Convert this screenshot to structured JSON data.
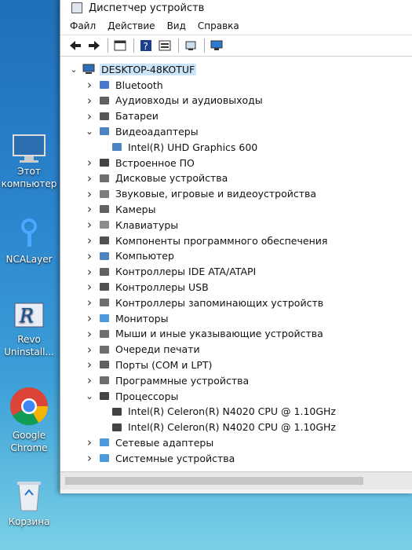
{
  "desktop": {
    "icons": [
      {
        "name": "this-pc",
        "label": "Этот компьютер"
      },
      {
        "name": "ncalayer",
        "label": "NCALayer"
      },
      {
        "name": "revo",
        "label": "Revo Uninstall..."
      },
      {
        "name": "chrome",
        "label": "Google Chrome"
      },
      {
        "name": "recycle",
        "label": "Корзина"
      }
    ]
  },
  "window": {
    "title": "Диспетчер устройств",
    "menu": [
      "Файл",
      "Действие",
      "Вид",
      "Справка"
    ]
  },
  "tree": {
    "root": "DESKTOP-48KOTUF",
    "items": [
      {
        "label": "Bluetooth",
        "expanded": false
      },
      {
        "label": "Аудиовходы и аудиовыходы",
        "expanded": false
      },
      {
        "label": "Батареи",
        "expanded": false
      },
      {
        "label": "Видеоадаптеры",
        "expanded": true
      },
      {
        "label": "Intel(R) UHD Graphics 600",
        "child": true
      },
      {
        "label": "Встроенное ПО",
        "expanded": false
      },
      {
        "label": "Дисковые устройства",
        "expanded": false
      },
      {
        "label": "Звуковые, игровые и видеоустройства",
        "expanded": false
      },
      {
        "label": "Камеры",
        "expanded": false
      },
      {
        "label": "Клавиатуры",
        "expanded": false
      },
      {
        "label": "Компоненты программного обеспечения",
        "expanded": false
      },
      {
        "label": "Компьютер",
        "expanded": false
      },
      {
        "label": "Контроллеры IDE ATA/ATAPI",
        "expanded": false
      },
      {
        "label": "Контроллеры USB",
        "expanded": false
      },
      {
        "label": "Контроллеры запоминающих устройств",
        "expanded": false
      },
      {
        "label": "Мониторы",
        "expanded": false
      },
      {
        "label": "Мыши и иные указывающие устройства",
        "expanded": false
      },
      {
        "label": "Очереди печати",
        "expanded": false
      },
      {
        "label": "Порты (COM и LPT)",
        "expanded": false
      },
      {
        "label": "Программные устройства",
        "expanded": false
      },
      {
        "label": "Процессоры",
        "expanded": true
      },
      {
        "label": "Intel(R) Celeron(R) N4020 CPU @ 1.10GHz",
        "child": true
      },
      {
        "label": "Intel(R) Celeron(R) N4020 CPU @ 1.10GHz",
        "child": true
      },
      {
        "label": "Сетевые адаптеры",
        "expanded": false
      },
      {
        "label": "Системные устройства",
        "expanded": false
      }
    ]
  }
}
